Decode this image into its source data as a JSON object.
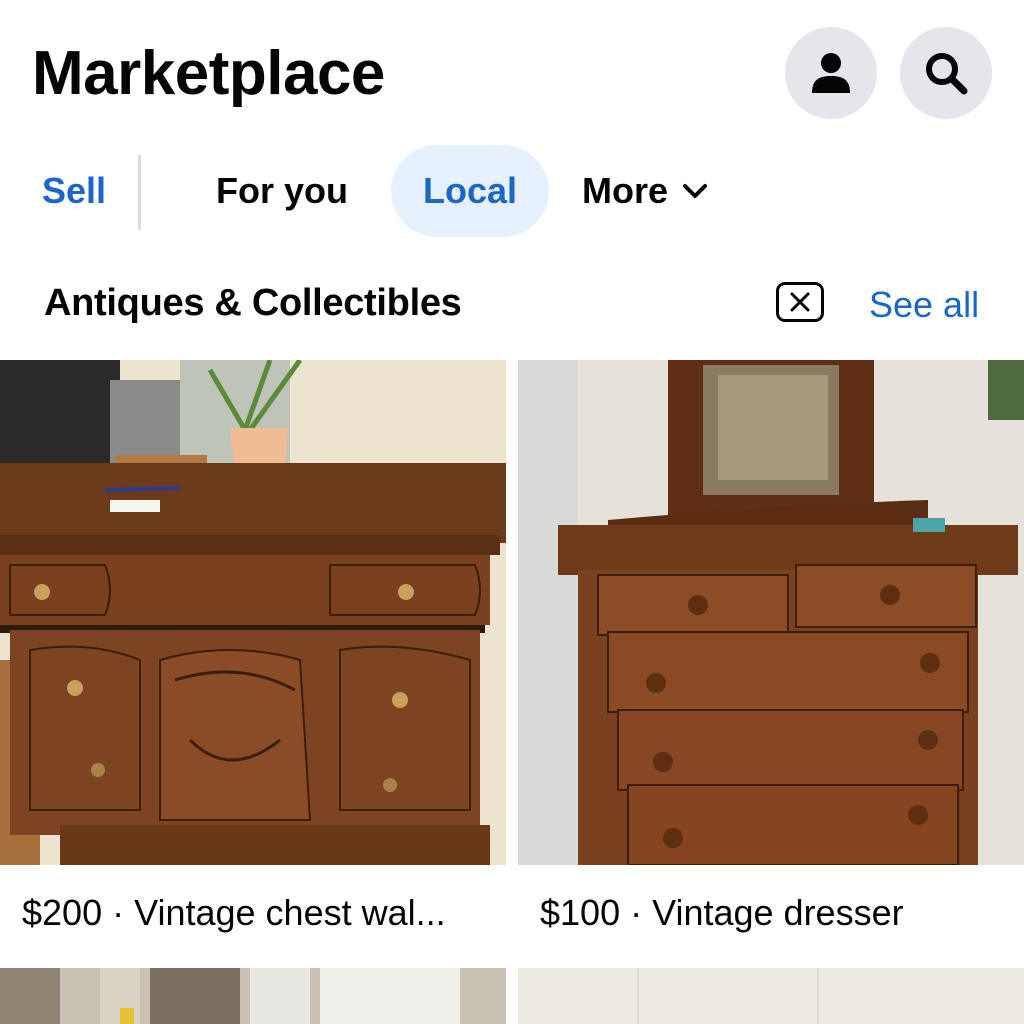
{
  "header": {
    "title": "Marketplace",
    "profile_icon": "person-icon",
    "search_icon": "search-icon"
  },
  "tabs": {
    "sell": "Sell",
    "for_you": "For you",
    "local": "Local",
    "more": "More"
  },
  "section": {
    "title": "Antiques & Collectibles",
    "dismiss_icon": "close-icon",
    "see_all": "See all"
  },
  "listings": [
    {
      "price": "$200",
      "separator": " · ",
      "title": "Vintage chest wal..."
    },
    {
      "price": "$100",
      "separator": " · ",
      "title": "Vintage dresser"
    }
  ],
  "colors": {
    "accent": "#1b67c9",
    "local_tab_bg": "#e7f1fd",
    "icon_button_bg": "#e4e6eb"
  }
}
